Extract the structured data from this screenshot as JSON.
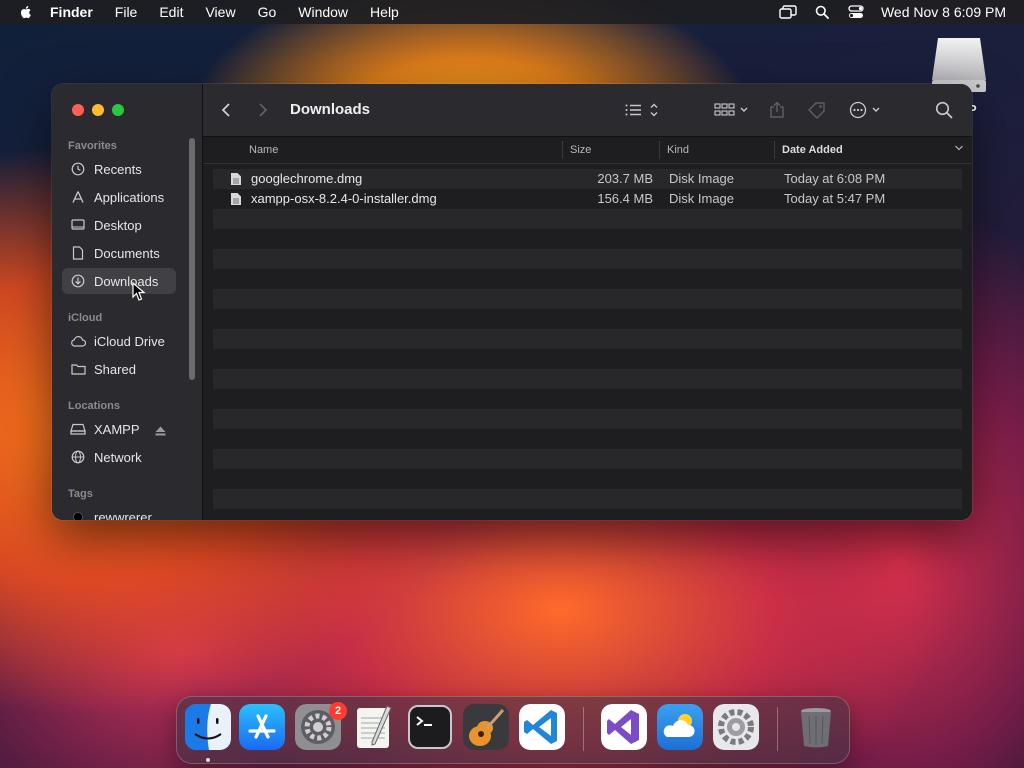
{
  "menubar": {
    "app_name": "Finder",
    "menus": [
      "File",
      "Edit",
      "View",
      "Go",
      "Window",
      "Help"
    ],
    "clock": "Wed Nov 8  6:09 PM"
  },
  "desktop": {
    "drive_label": "P"
  },
  "window": {
    "title": "Downloads",
    "sidebar": {
      "favorites_title": "Favorites",
      "favorites": [
        {
          "label": "Recents",
          "icon": "clock-icon"
        },
        {
          "label": "Applications",
          "icon": "applications-icon"
        },
        {
          "label": "Desktop",
          "icon": "desktop-icon"
        },
        {
          "label": "Documents",
          "icon": "document-icon"
        },
        {
          "label": "Downloads",
          "icon": "download-icon",
          "selected": true
        }
      ],
      "icloud_title": "iCloud",
      "icloud": [
        {
          "label": "iCloud Drive",
          "icon": "cloud-icon"
        },
        {
          "label": "Shared",
          "icon": "shared-folder-icon"
        }
      ],
      "locations_title": "Locations",
      "locations": [
        {
          "label": "XAMPP",
          "icon": "drive-icon"
        },
        {
          "label": "Network",
          "icon": "globe-icon"
        }
      ],
      "tags_title": "Tags",
      "tags": [
        {
          "label": "rewwrerer",
          "color": "#000000"
        }
      ]
    },
    "columns": {
      "name": "Name",
      "size": "Size",
      "kind": "Kind",
      "date_added": "Date Added"
    },
    "files": [
      {
        "name": "googlechrome.dmg",
        "size": "203.7 MB",
        "kind": "Disk Image",
        "date_added": "Today at 6:08 PM"
      },
      {
        "name": "xampp-osx-8.2.4-0-installer.dmg",
        "size": "156.4 MB",
        "kind": "Disk Image",
        "date_added": "Today at 5:47 PM"
      }
    ]
  },
  "dock": {
    "apps": [
      {
        "name": "Finder",
        "icon": "finder-icon"
      },
      {
        "name": "App Store",
        "icon": "app-store-icon"
      },
      {
        "name": "System Preferences",
        "icon": "system-preferences-icon",
        "badge": "2"
      },
      {
        "name": "TextEdit",
        "icon": "textedit-icon"
      },
      {
        "name": "Terminal",
        "icon": "terminal-icon"
      },
      {
        "name": "GarageBand",
        "icon": "garageband-icon"
      },
      {
        "name": "Visual Studio Code",
        "icon": "vscode-icon"
      },
      {
        "name": "Visual Studio",
        "icon": "visual-studio-icon"
      },
      {
        "name": "Weather",
        "icon": "weather-icon"
      },
      {
        "name": "Settings",
        "icon": "settings-icon"
      },
      {
        "name": "Trash",
        "icon": "trash-icon"
      }
    ]
  },
  "colors": {
    "close": "#ff5f57",
    "minimize": "#febc2e",
    "maximize": "#28c840",
    "badge": "#ff3b30"
  }
}
